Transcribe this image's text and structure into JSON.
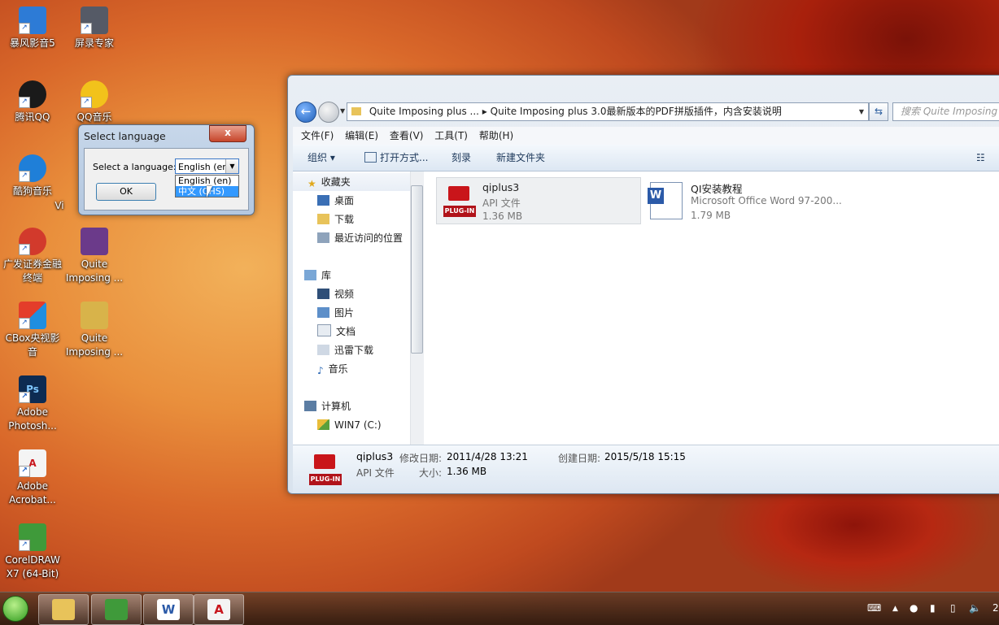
{
  "desktop_icons": [
    {
      "label": "暴风影音5",
      "color": "#2d7bd6"
    },
    {
      "label": "屏录专家",
      "color": "#555a66"
    },
    {
      "label": "腾讯QQ",
      "color": "#1a1a1a"
    },
    {
      "label": "QQ音乐",
      "color": "#f2c21b"
    },
    {
      "label": "酷狗音乐",
      "color": "#1f7fd8"
    },
    {
      "label": "Vi",
      "color": "#d9682a"
    },
    {
      "label": "广发证券金融终端",
      "color": "#d23a2c"
    },
    {
      "label": "Quite Imposing ...",
      "color": "#6b3a8a"
    },
    {
      "label": "CBox央视影音",
      "color": "#e43d2a"
    },
    {
      "label": "Quite Imposing ...",
      "color": "#d8b34a"
    },
    {
      "label": "Adobe Photosh...",
      "color": "#0d2b52"
    },
    {
      "label": "Adobe Acrobat...",
      "color": "#f4f4f4"
    },
    {
      "label": "CorelDRAW X7 (64-Bit)",
      "color": "#3f9a3a"
    }
  ],
  "explorer": {
    "address": "Quite Imposing plus ...  ▸  Quite Imposing plus 3.0最新版本的PDF拼版插件，内含安装说明",
    "search_placeholder": "搜索 Quite Imposing plus ...",
    "menu": [
      "文件(F)",
      "编辑(E)",
      "查看(V)",
      "工具(T)",
      "帮助(H)"
    ],
    "toolbar": {
      "organize": "组织 ▾",
      "open_with": "打开方式...",
      "burn": "刻录",
      "new_folder": "新建文件夹"
    },
    "nav": {
      "favorites": "收藏夹",
      "desktop": "桌面",
      "downloads": "下载",
      "recent": "最近访问的位置",
      "libraries": "库",
      "videos": "视频",
      "pictures": "图片",
      "documents": "文档",
      "thunder": "迅雷下载",
      "music": "音乐",
      "computer": "计算机",
      "drive_c": "WIN7 (C:)"
    },
    "files": [
      {
        "name": "qiplus3",
        "type": "API 文件",
        "size": "1.36 MB"
      },
      {
        "name": "QI安装教程",
        "type": "Microsoft Office Word 97-200...",
        "size": "1.79 MB"
      }
    ],
    "details": {
      "name": "qiplus3",
      "type": "API 文件",
      "modified_label": "修改日期:",
      "modified": "2011/4/28 13:21",
      "created_label": "创建日期:",
      "created": "2015/5/18 15:15",
      "size_label": "大小:",
      "size": "1.36 MB"
    }
  },
  "dialog": {
    "title": "Select language",
    "label": "Select a language:",
    "selected": "English (en)",
    "options": [
      "English (en)",
      "中文 (CHS)"
    ],
    "ok": "OK",
    "close": "x"
  },
  "taskbar": {
    "tray_text": "2"
  }
}
